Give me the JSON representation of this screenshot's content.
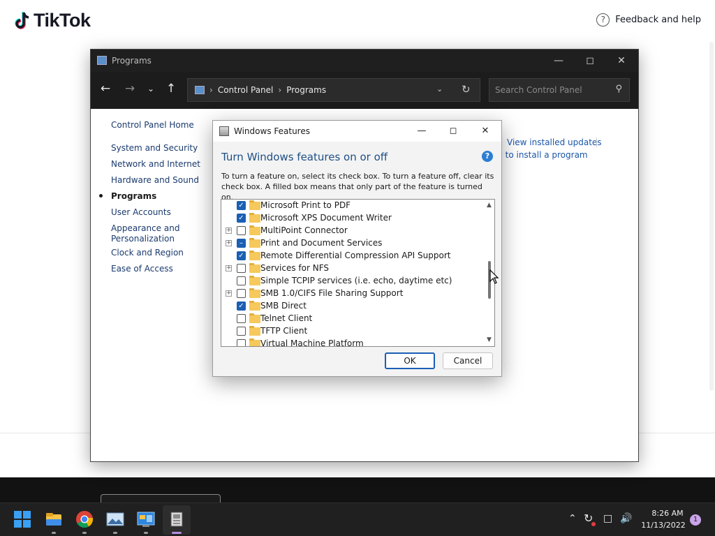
{
  "tiktok": {
    "brand": "TikTok",
    "feedback_label": "Feedback and help"
  },
  "cp_window": {
    "title": "Programs",
    "breadcrumb": [
      "Control Panel",
      "Programs"
    ],
    "search_placeholder": "Search Control Panel",
    "sidebar": [
      "Control Panel Home",
      "System and Security",
      "Network and Internet",
      "Hardware and Sound",
      "Programs",
      "User Accounts",
      "Appearance and Personalization",
      "Clock and Region",
      "Ease of Access"
    ],
    "active_item": "Programs",
    "links": {
      "installed_updates": "View installed updates",
      "install_program": "w to install a program"
    }
  },
  "dialog": {
    "title": "Windows Features",
    "heading": "Turn Windows features on or off",
    "description": "To turn a feature on, select its check box. To turn a feature off, clear its check box. A filled box means that only part of the feature is turned on.",
    "features": [
      {
        "label": "Microsoft Print to PDF",
        "state": "checked",
        "expandable": false
      },
      {
        "label": "Microsoft XPS Document Writer",
        "state": "checked",
        "expandable": false
      },
      {
        "label": "MultiPoint Connector",
        "state": "unchecked",
        "expandable": true
      },
      {
        "label": "Print and Document Services",
        "state": "partial",
        "expandable": true
      },
      {
        "label": "Remote Differential Compression API Support",
        "state": "checked",
        "expandable": false
      },
      {
        "label": "Services for NFS",
        "state": "unchecked",
        "expandable": true
      },
      {
        "label": "Simple TCPIP services (i.e. echo, daytime etc)",
        "state": "unchecked",
        "expandable": false
      },
      {
        "label": "SMB 1.0/CIFS File Sharing Support",
        "state": "unchecked",
        "expandable": true
      },
      {
        "label": "SMB Direct",
        "state": "checked",
        "expandable": false
      },
      {
        "label": "Telnet Client",
        "state": "unchecked",
        "expandable": false
      },
      {
        "label": "TFTP Client",
        "state": "unchecked",
        "expandable": false
      },
      {
        "label": "Virtual Machine Platform",
        "state": "unchecked",
        "expandable": false
      }
    ],
    "ok_label": "OK",
    "cancel_label": "Cancel"
  },
  "taskbar": {
    "apps": [
      "start-icon",
      "file-explorer-icon",
      "chrome-icon",
      "photos-icon",
      "control-panel-icon",
      "windows-features-icon"
    ],
    "time": "8:26 AM",
    "date": "11/13/2022",
    "notifications": "1"
  },
  "colors": {
    "accent": "#1a5fb4",
    "dark_chrome": "#1f1f1f",
    "link": "#1a3a6e"
  }
}
